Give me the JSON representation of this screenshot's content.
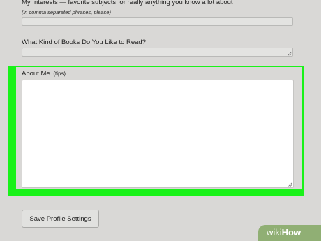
{
  "interests": {
    "label": "My Interests — favorite subjects, or really anything you know a lot about",
    "hint": "(in comma separated phrases, please)",
    "value": ""
  },
  "books": {
    "label": "What Kind of Books Do You Like to Read?",
    "value": ""
  },
  "about_me": {
    "label": "About Me",
    "tips_label": "(tips)",
    "value": ""
  },
  "save_button_label": "Save Profile Settings",
  "highlight_color": "#19f219",
  "watermark": {
    "wiki": "wiki",
    "how": "How"
  }
}
